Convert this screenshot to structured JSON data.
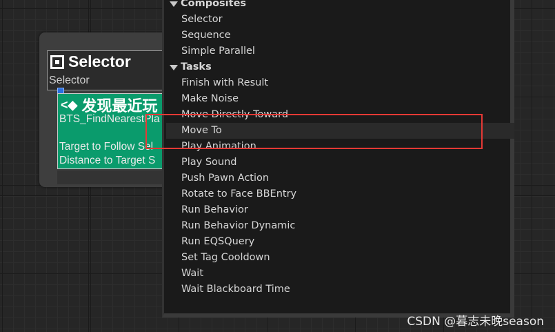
{
  "node": {
    "title": "Selector",
    "subtitle": "Selector",
    "service": {
      "title": "发现最近玩",
      "line1": "BTS_FindNearestPla",
      "line2": "Target to Follow Sel",
      "line3": "Distance to Target S"
    }
  },
  "menu": {
    "categories": {
      "composites": "Composites",
      "tasks": "Tasks"
    },
    "composites": [
      "Selector",
      "Sequence",
      "Simple Parallel"
    ],
    "tasks": [
      "Finish with Result",
      "Make Noise",
      "Move Directly Toward",
      "Move To",
      "Play Animation",
      "Play Sound",
      "Push Pawn Action",
      "Rotate to Face BBEntry",
      "Run Behavior",
      "Run Behavior Dynamic",
      "Run EQSQuery",
      "Set Tag Cooldown",
      "Wait",
      "Wait Blackboard Time"
    ],
    "highlighted": "Move To"
  },
  "annotation": {
    "color": "#e53935"
  },
  "watermark": "CSDN @暮志未晚season"
}
